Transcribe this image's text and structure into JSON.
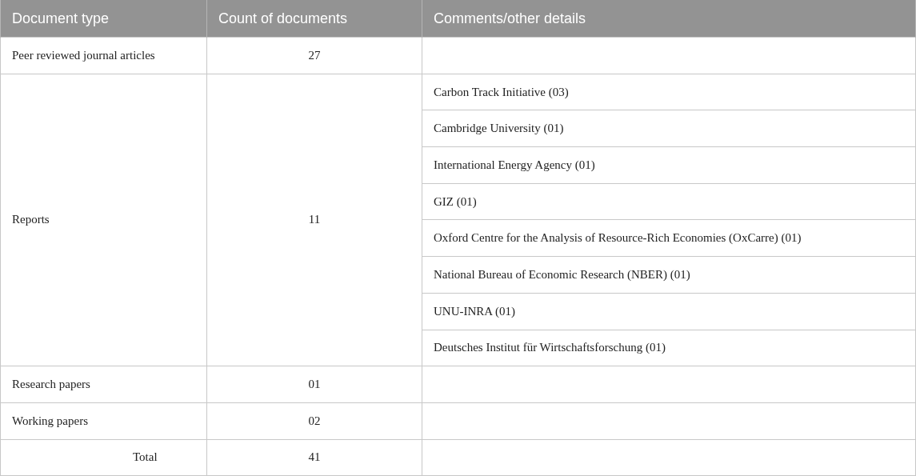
{
  "table": {
    "columns": [
      "Document type",
      "Count of documents",
      "Comments/other details"
    ],
    "rows": [
      {
        "kind": "regular",
        "document_type": "Peer reviewed journal articles",
        "count": "27",
        "comments": []
      },
      {
        "kind": "regular",
        "document_type": "Reports",
        "count": "11",
        "comments": [
          "Carbon Track Initiative (03)",
          "Cambridge University (01)",
          "International Energy Agency (01)",
          "GIZ (01)",
          "Oxford Centre for the Analysis of Resource-Rich Economies (OxCarre) (01)",
          "National Bureau of Economic Research (NBER) (01)",
          "UNU-INRA (01)",
          "Deutsches Institut für Wirtschaftsforschung (01)"
        ]
      },
      {
        "kind": "regular",
        "document_type": "Research papers",
        "count": "01",
        "comments": []
      },
      {
        "kind": "regular",
        "document_type": "Working papers",
        "count": "02",
        "comments": []
      },
      {
        "kind": "total",
        "document_type": "Total",
        "count": "41",
        "comments": []
      }
    ]
  }
}
